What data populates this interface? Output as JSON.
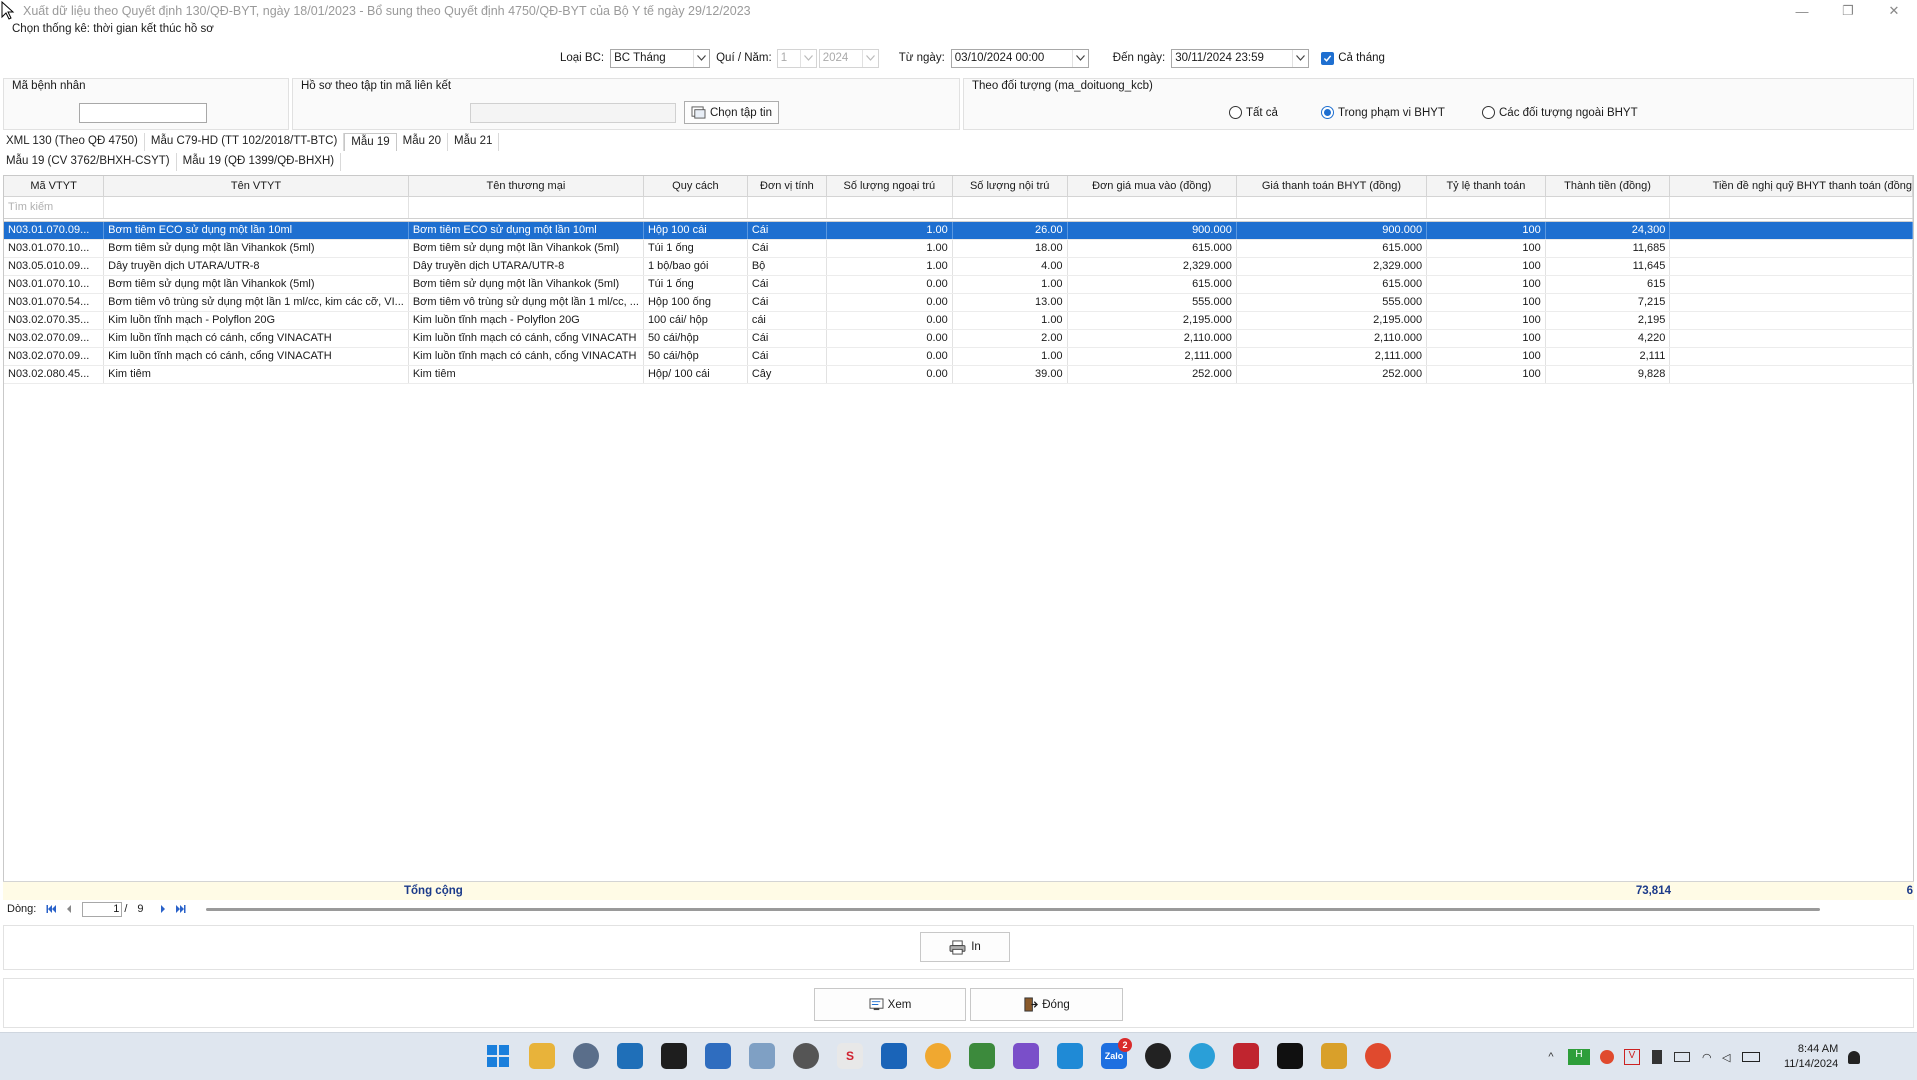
{
  "window": {
    "title": "Xuất dữ liệu theo Quyết định 130/QĐ-BYT, ngày 18/01/2023 - Bổ sung theo Quyết định 4750/QĐ-BYT của Bộ Y tế ngày 29/12/2023",
    "minimize": "—",
    "maximize": "❐",
    "close": "✕"
  },
  "filters": {
    "section_label": "Chọn thống kê: thời gian kết thúc hồ sơ",
    "report_type_label": "Loại BC:",
    "report_type_value": "BC Tháng",
    "quarter_year_label": "Quí / Năm:",
    "quarter_value": "1",
    "year_value": "2024",
    "from_date_label": "Từ ngày:",
    "from_date_value": "03/10/2024 00:00",
    "to_date_label": "Đến ngày:",
    "to_date_value": "30/11/2024 23:59",
    "whole_month_label": "Cả tháng",
    "whole_month_checked": true
  },
  "patient_group": {
    "title": "Mã bệnh nhân",
    "value": ""
  },
  "file_group": {
    "title": "Hồ sơ theo tập tin mã liên kết",
    "value": "",
    "choose_button": "Chọn tập tin"
  },
  "subject_group": {
    "title": "Theo đối tượng (ma_doituong_kcb)",
    "options": [
      {
        "label": "Tất cả",
        "selected": false
      },
      {
        "label": "Trong phạm vi BHYT",
        "selected": true
      },
      {
        "label": "Các đối tượng ngoài BHYT",
        "selected": false
      }
    ]
  },
  "tabs_row1": [
    "XML 130 (Theo QĐ 4750)",
    "Mẫu C79-HD (TT 102/2018/TT-BTC)",
    "Mẫu 19",
    "Mẫu 20",
    "Mẫu 21"
  ],
  "active_tab": "Mẫu 19",
  "tabs_row2": [
    "Mẫu 19 (CV 3762/BHXH-CSYT)",
    "Mẫu 19 (QĐ 1399/QĐ-BHXH)"
  ],
  "grid": {
    "columns": [
      "Mã VTYT",
      "Tên VTYT",
      "Tên thương mại",
      "Quy cách",
      "Đơn vị tính",
      "Số lượng ngoại trú",
      "Số lượng nội trú",
      "Đơn giá mua vào (đồng)",
      "Giá thanh toán BHYT (đồng)",
      "Tỷ lệ thanh toán",
      "Thành tiền (đồng)",
      "Tiền đề nghị quỹ BHYT thanh toán (đồng"
    ],
    "search_placeholder": "Tìm kiếm",
    "rows": [
      [
        "N03.01.070.09...",
        "Bơm tiêm ECO sử dụng một lần 10ml",
        "Bơm tiêm ECO sử dụng một lần 10ml",
        "Hộp 100 cái",
        "Cái",
        "1.00",
        "26.00",
        "900.000",
        "900.000",
        "100",
        "24,300",
        ""
      ],
      [
        "N03.01.070.10...",
        "Bơm tiêm sử dụng một lần Vihankok (5ml)",
        "Bơm tiêm sử dụng một lần Vihankok (5ml)",
        "Túi 1 ống",
        "Cái",
        "1.00",
        "18.00",
        "615.000",
        "615.000",
        "100",
        "11,685",
        ""
      ],
      [
        "N03.05.010.09...",
        "Dây truyền dịch UTARA/UTR-8",
        "Dây truyền dịch UTARA/UTR-8",
        "1 bộ/bao gói",
        "Bộ",
        "1.00",
        "4.00",
        "2,329.000",
        "2,329.000",
        "100",
        "11,645",
        ""
      ],
      [
        "N03.01.070.10...",
        "Bơm tiêm sử dụng một lần Vihankok (5ml)",
        "Bơm tiêm sử dụng một lần Vihankok (5ml)",
        "Túi 1 ống",
        "Cái",
        "0.00",
        "1.00",
        "615.000",
        "615.000",
        "100",
        "615",
        ""
      ],
      [
        "N03.01.070.54...",
        "Bơm tiêm vô trùng sử dụng một lần 1 ml/cc, kim các cỡ, VI...",
        "Bơm tiêm vô trùng sử dụng một lần 1 ml/cc, ...",
        "Hộp 100 ống",
        "Cái",
        "0.00",
        "13.00",
        "555.000",
        "555.000",
        "100",
        "7,215",
        ""
      ],
      [
        "N03.02.070.35...",
        "Kim luồn tĩnh mạch - Polyflon 20G",
        "Kim luồn tĩnh mạch - Polyflon 20G",
        "100 cái/ hộp",
        "cái",
        "0.00",
        "1.00",
        "2,195.000",
        "2,195.000",
        "100",
        "2,195",
        ""
      ],
      [
        "N03.02.070.09...",
        "Kim luồn tĩnh mạch có cánh, cổng VINACATH",
        "Kim luồn tĩnh mạch có cánh, cổng VINACATH",
        "50 cái/hộp",
        "Cái",
        "0.00",
        "2.00",
        "2,110.000",
        "2,110.000",
        "100",
        "4,220",
        ""
      ],
      [
        "N03.02.070.09...",
        "Kim luồn tĩnh mạch có cánh, cổng VINACATH",
        "Kim luồn tĩnh mạch có cánh, cổng VINACATH",
        "50 cái/hộp",
        "Cái",
        "0.00",
        "1.00",
        "2,111.000",
        "2,111.000",
        "100",
        "2,111",
        ""
      ],
      [
        "N03.02.080.45...",
        "Kim tiêm",
        "Kim tiêm",
        "Hộp/ 100 cái",
        "Cây",
        "0.00",
        "39.00",
        "252.000",
        "252.000",
        "100",
        "9,828",
        ""
      ]
    ],
    "total_label": "Tổng cộng",
    "total_amount": "73,814",
    "total_partial": "6"
  },
  "pager": {
    "label": "Dòng:",
    "current": "1",
    "separator": "/",
    "total": "9"
  },
  "buttons": {
    "print": "In",
    "view": "Xem",
    "close": "Đóng"
  },
  "taskbar": {
    "zalo_badge": "2",
    "time": "8:44 AM",
    "date": "11/14/2024"
  },
  "colors": {
    "selection": "#1e6fd0",
    "total_text": "#1b3a8a",
    "total_bg": "#fffbe6"
  }
}
